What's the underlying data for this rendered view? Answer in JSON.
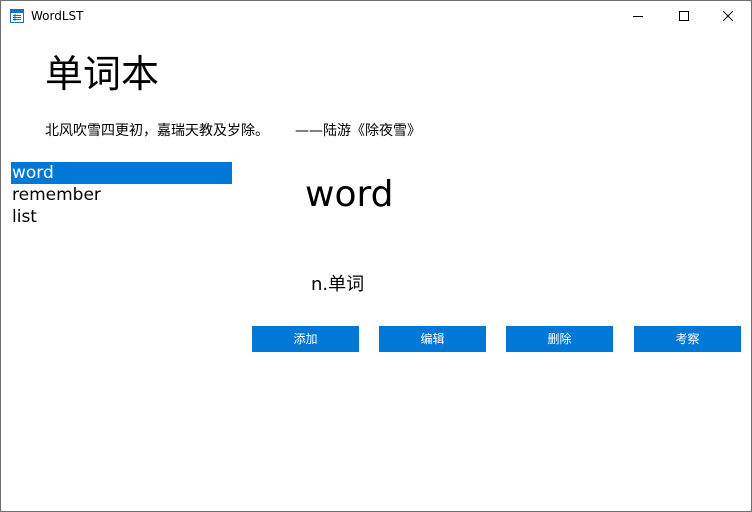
{
  "window": {
    "title": "WordLST",
    "accent_color": "#0078d7"
  },
  "header": {
    "title": "单词本",
    "poem_line": "北风吹雪四更初，嘉瑞天教及岁除。",
    "poem_author": "——陆游《除夜雪》"
  },
  "word_list": {
    "items": [
      {
        "label": "word",
        "selected": true
      },
      {
        "label": "remember",
        "selected": false
      },
      {
        "label": "list",
        "selected": false
      }
    ]
  },
  "detail": {
    "word": "word",
    "meaning": "n.单词"
  },
  "actions": {
    "add_label": "添加",
    "edit_label": "编辑",
    "delete_label": "删除",
    "quiz_label": "考察"
  }
}
